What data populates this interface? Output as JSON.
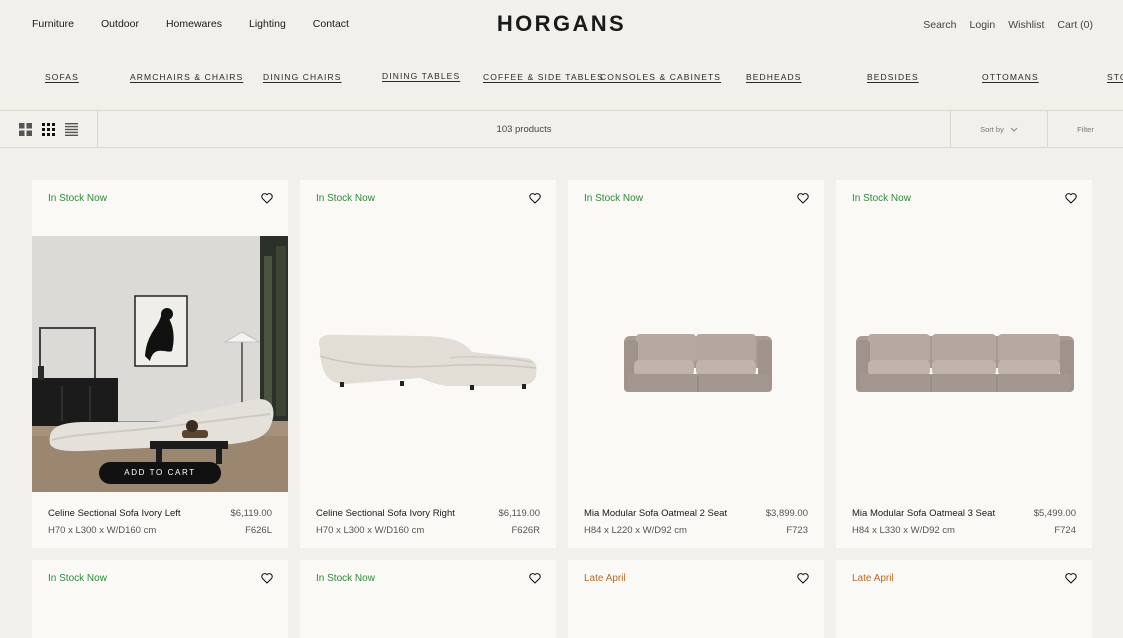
{
  "header": {
    "logo": "HORGANS",
    "main_nav": [
      "Furniture",
      "Outdoor",
      "Homewares",
      "Lighting",
      "Contact"
    ],
    "util_nav": [
      "Search",
      "Login",
      "Wishlist",
      "Cart (0)"
    ]
  },
  "categories": [
    "SOFAS",
    "ARMCHAIRS & CHAIRS",
    "DINING CHAIRS",
    "DINING TABLES",
    "COFFEE & SIDE TABLES",
    "CONSOLES & CABINETS",
    "BEDHEADS",
    "BEDSIDES",
    "OTTOMANS",
    "STO"
  ],
  "toolbar": {
    "count": "103 products",
    "sort_label": "Sort by",
    "filter_label": "Filter"
  },
  "colors": {
    "in_stock": "#2e8a3a",
    "late": "#b86a2a",
    "background": "#f2f0ea",
    "card": "#faf9f6"
  },
  "products": [
    {
      "status": "In Stock Now",
      "name": "Celine Sectional Sofa Ivory Left",
      "price": "$6,119.00",
      "dims": "H70 x L300 x W/D160 cm",
      "code": "F626L",
      "cta": "ADD TO CART"
    },
    {
      "status": "In Stock Now",
      "name": "Celine Sectional Sofa Ivory Right",
      "price": "$6,119.00",
      "dims": "H70 x L300 x W/D160 cm",
      "code": "F626R"
    },
    {
      "status": "In Stock Now",
      "name": "Mia Modular Sofa Oatmeal 2 Seat",
      "price": "$3,899.00",
      "dims": "H84 x L220 x W/D92 cm",
      "code": "F723"
    },
    {
      "status": "In Stock Now",
      "name": "Mia Modular Sofa Oatmeal 3 Seat",
      "price": "$5,499.00",
      "dims": "H84 x L330 x W/D92 cm",
      "code": "F724"
    },
    {
      "status": "In Stock Now"
    },
    {
      "status": "In Stock Now"
    },
    {
      "status": "Late April"
    },
    {
      "status": "Late April"
    }
  ]
}
